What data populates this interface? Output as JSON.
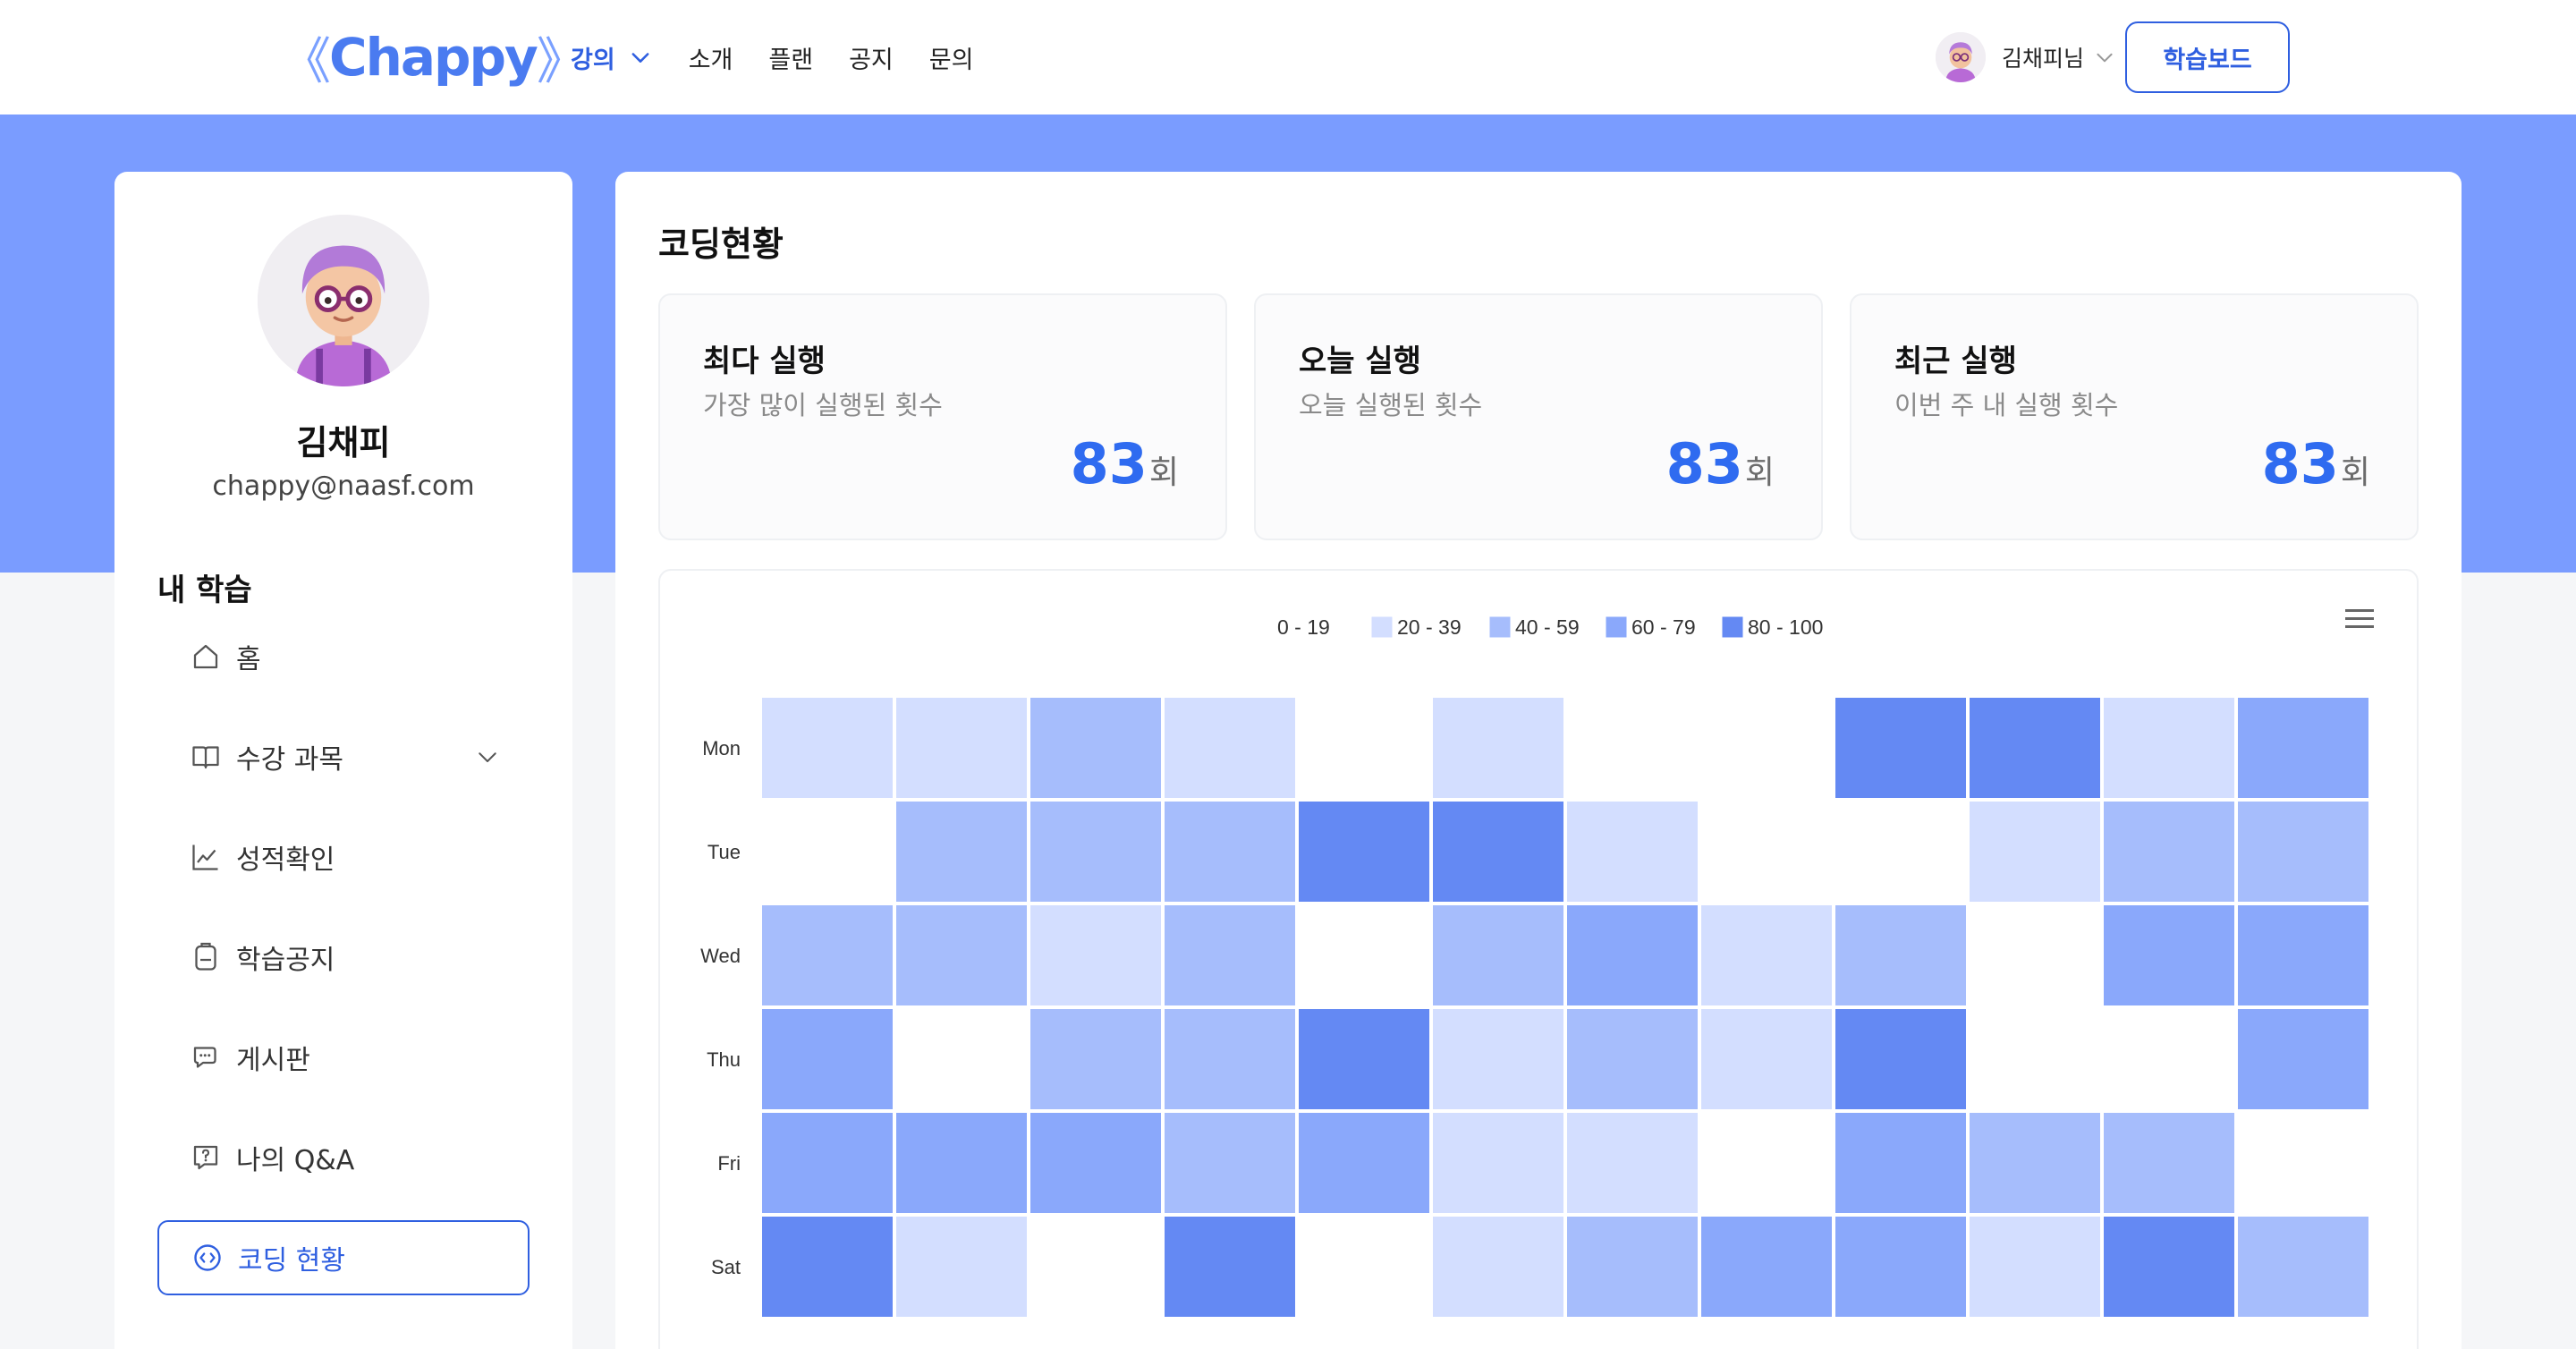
{
  "header": {
    "logo": {
      "left": "《",
      "brand": "Chappy",
      "right": "》"
    },
    "nav": [
      {
        "label": "강의",
        "active": true,
        "has_dropdown": true
      },
      {
        "label": "소개",
        "active": false
      },
      {
        "label": "플랜",
        "active": false
      },
      {
        "label": "공지",
        "active": false
      },
      {
        "label": "문의",
        "active": false
      }
    ],
    "user_name": "김채피님",
    "board_button": "학습보드"
  },
  "sidebar": {
    "name": "김채피",
    "email": "chappy@naasf.com",
    "section_title": "내 학습",
    "items": [
      {
        "label": "홈",
        "icon": "home-icon"
      },
      {
        "label": "수강 과목",
        "icon": "book-icon",
        "has_dropdown": true
      },
      {
        "label": "성적확인",
        "icon": "chart-line-icon"
      },
      {
        "label": "학습공지",
        "icon": "notice-icon"
      },
      {
        "label": "게시판",
        "icon": "chat-icon"
      },
      {
        "label": "나의 Q&A",
        "icon": "question-icon"
      },
      {
        "label": "코딩 현황",
        "icon": "code-icon",
        "active": true
      }
    ]
  },
  "main": {
    "title": "코딩현황",
    "stats": [
      {
        "title": "최다 실행",
        "subtitle": "가장 많이 실행된 횟수",
        "value": "83",
        "unit": "회"
      },
      {
        "title": "오늘 실행",
        "subtitle": "오늘 실행된 횟수",
        "value": "83",
        "unit": "회"
      },
      {
        "title": "최근 실행",
        "subtitle": "이번 주 내 실행 횟수",
        "value": "83",
        "unit": "회"
      }
    ]
  },
  "colors": {
    "accent": "#2f5fe0",
    "band": "#7a9cff",
    "value": "#2f6bf0"
  },
  "chart_data": {
    "type": "heatmap",
    "legend": [
      {
        "label": "0 - 19",
        "color": "#ffffff"
      },
      {
        "label": "20 - 39",
        "color": "#d3deff"
      },
      {
        "label": "40 - 59",
        "color": "#a6bdfc"
      },
      {
        "label": "60 - 79",
        "color": "#8aa8fb"
      },
      {
        "label": "80 - 100",
        "color": "#6489f3"
      }
    ],
    "rows": [
      "Mon",
      "Tue",
      "Wed",
      "Thu",
      "Fri",
      "Sat"
    ],
    "columns": 12,
    "bins": [
      [
        1,
        1,
        2,
        1,
        0,
        1,
        0,
        0,
        4,
        4,
        1,
        3
      ],
      [
        0,
        2,
        2,
        2,
        4,
        4,
        1,
        0,
        0,
        1,
        2,
        2
      ],
      [
        2,
        2,
        1,
        2,
        0,
        2,
        3,
        1,
        2,
        0,
        3,
        3
      ],
      [
        3,
        0,
        2,
        2,
        4,
        1,
        2,
        1,
        4,
        0,
        0,
        3
      ],
      [
        3,
        3,
        3,
        2,
        3,
        1,
        1,
        0,
        3,
        2,
        2,
        0
      ],
      [
        4,
        1,
        0,
        4,
        0,
        1,
        2,
        3,
        3,
        1,
        4,
        2
      ]
    ]
  }
}
